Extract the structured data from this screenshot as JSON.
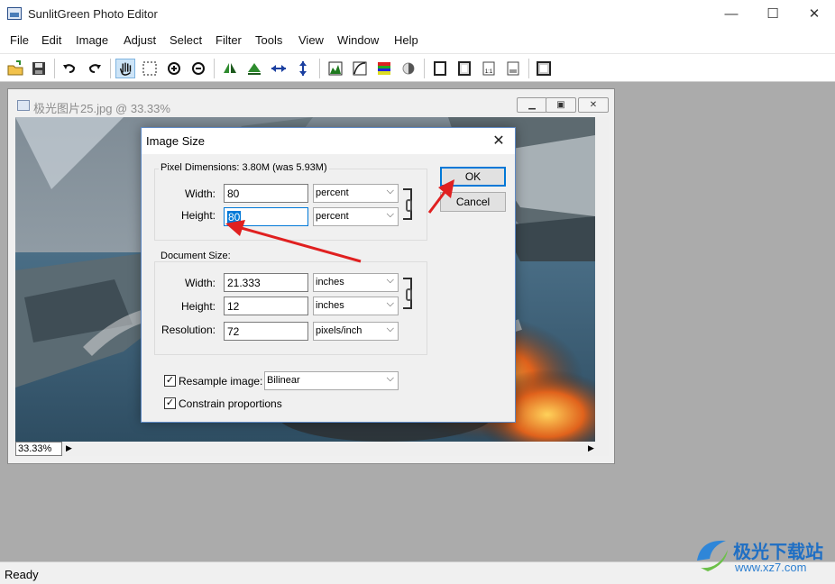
{
  "app": {
    "title": "SunlitGreen Photo Editor",
    "window_buttons": {
      "minimize": "—",
      "maximize": "☐",
      "close": "✕"
    }
  },
  "menu": [
    "File",
    "Edit",
    "Image",
    "Adjust",
    "Select",
    "Filter",
    "Tools",
    "View",
    "Window",
    "Help"
  ],
  "toolbar": {
    "icons": [
      "open-icon",
      "save-icon",
      "undo-icon",
      "redo-icon",
      "hand-icon",
      "marquee-icon",
      "zoom-in-icon",
      "zoom-out-icon",
      "flip-horizontal-icon",
      "flip-vertical-icon",
      "resize-width-icon",
      "resize-height-icon",
      "levels-icon",
      "curves-icon",
      "color-balance-icon",
      "brightness-icon",
      "frame-icon",
      "border-icon",
      "crop-1to1-icon",
      "crop-ratio-icon",
      "screen-icon"
    ]
  },
  "image_window": {
    "title": "极光图片25.jpg @ 33.33%",
    "zoom": "33.33%"
  },
  "dialog": {
    "title": "Image Size",
    "close": "✕",
    "pixel_dimensions": {
      "label": "Pixel Dimensions:",
      "value": "3.80M (was 5.93M)",
      "width_label": "Width:",
      "width_value": "80",
      "width_unit": "percent",
      "height_label": "Height:",
      "height_value": "80",
      "height_unit": "percent"
    },
    "document_size": {
      "label": "Document Size:",
      "width_label": "Width:",
      "width_value": "21.333",
      "width_unit": "inches",
      "height_label": "Height:",
      "height_value": "12",
      "height_unit": "inches",
      "resolution_label": "Resolution:",
      "resolution_value": "72",
      "resolution_unit": "pixels/inch"
    },
    "resample": {
      "label": "Resample image:",
      "checked": true,
      "method": "Bilinear"
    },
    "constrain": {
      "label": "Constrain proportions",
      "checked": true
    },
    "ok_label": "OK",
    "cancel_label": "Cancel"
  },
  "status": "Ready",
  "watermark": {
    "site_name": "极光下载站",
    "url": "www.xz7.com"
  },
  "colors": {
    "accent": "#0078d7",
    "annotation_arrow": "#e02020",
    "workspace": "#ababab"
  }
}
